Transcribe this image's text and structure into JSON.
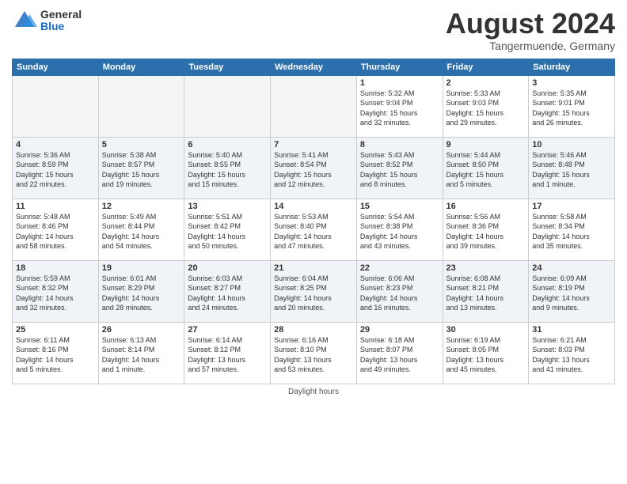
{
  "logo": {
    "general": "General",
    "blue": "Blue"
  },
  "title": "August 2024",
  "location": "Tangermuende, Germany",
  "days_header": [
    "Sunday",
    "Monday",
    "Tuesday",
    "Wednesday",
    "Thursday",
    "Friday",
    "Saturday"
  ],
  "footer": "Daylight hours",
  "weeks": [
    [
      {
        "num": "",
        "info": ""
      },
      {
        "num": "",
        "info": ""
      },
      {
        "num": "",
        "info": ""
      },
      {
        "num": "",
        "info": ""
      },
      {
        "num": "1",
        "info": "Sunrise: 5:32 AM\nSunset: 9:04 PM\nDaylight: 15 hours\nand 32 minutes."
      },
      {
        "num": "2",
        "info": "Sunrise: 5:33 AM\nSunset: 9:03 PM\nDaylight: 15 hours\nand 29 minutes."
      },
      {
        "num": "3",
        "info": "Sunrise: 5:35 AM\nSunset: 9:01 PM\nDaylight: 15 hours\nand 26 minutes."
      }
    ],
    [
      {
        "num": "4",
        "info": "Sunrise: 5:36 AM\nSunset: 8:59 PM\nDaylight: 15 hours\nand 22 minutes."
      },
      {
        "num": "5",
        "info": "Sunrise: 5:38 AM\nSunset: 8:57 PM\nDaylight: 15 hours\nand 19 minutes."
      },
      {
        "num": "6",
        "info": "Sunrise: 5:40 AM\nSunset: 8:55 PM\nDaylight: 15 hours\nand 15 minutes."
      },
      {
        "num": "7",
        "info": "Sunrise: 5:41 AM\nSunset: 8:54 PM\nDaylight: 15 hours\nand 12 minutes."
      },
      {
        "num": "8",
        "info": "Sunrise: 5:43 AM\nSunset: 8:52 PM\nDaylight: 15 hours\nand 8 minutes."
      },
      {
        "num": "9",
        "info": "Sunrise: 5:44 AM\nSunset: 8:50 PM\nDaylight: 15 hours\nand 5 minutes."
      },
      {
        "num": "10",
        "info": "Sunrise: 5:46 AM\nSunset: 8:48 PM\nDaylight: 15 hours\nand 1 minute."
      }
    ],
    [
      {
        "num": "11",
        "info": "Sunrise: 5:48 AM\nSunset: 8:46 PM\nDaylight: 14 hours\nand 58 minutes."
      },
      {
        "num": "12",
        "info": "Sunrise: 5:49 AM\nSunset: 8:44 PM\nDaylight: 14 hours\nand 54 minutes."
      },
      {
        "num": "13",
        "info": "Sunrise: 5:51 AM\nSunset: 8:42 PM\nDaylight: 14 hours\nand 50 minutes."
      },
      {
        "num": "14",
        "info": "Sunrise: 5:53 AM\nSunset: 8:40 PM\nDaylight: 14 hours\nand 47 minutes."
      },
      {
        "num": "15",
        "info": "Sunrise: 5:54 AM\nSunset: 8:38 PM\nDaylight: 14 hours\nand 43 minutes."
      },
      {
        "num": "16",
        "info": "Sunrise: 5:56 AM\nSunset: 8:36 PM\nDaylight: 14 hours\nand 39 minutes."
      },
      {
        "num": "17",
        "info": "Sunrise: 5:58 AM\nSunset: 8:34 PM\nDaylight: 14 hours\nand 35 minutes."
      }
    ],
    [
      {
        "num": "18",
        "info": "Sunrise: 5:59 AM\nSunset: 8:32 PM\nDaylight: 14 hours\nand 32 minutes."
      },
      {
        "num": "19",
        "info": "Sunrise: 6:01 AM\nSunset: 8:29 PM\nDaylight: 14 hours\nand 28 minutes."
      },
      {
        "num": "20",
        "info": "Sunrise: 6:03 AM\nSunset: 8:27 PM\nDaylight: 14 hours\nand 24 minutes."
      },
      {
        "num": "21",
        "info": "Sunrise: 6:04 AM\nSunset: 8:25 PM\nDaylight: 14 hours\nand 20 minutes."
      },
      {
        "num": "22",
        "info": "Sunrise: 6:06 AM\nSunset: 8:23 PM\nDaylight: 14 hours\nand 16 minutes."
      },
      {
        "num": "23",
        "info": "Sunrise: 6:08 AM\nSunset: 8:21 PM\nDaylight: 14 hours\nand 13 minutes."
      },
      {
        "num": "24",
        "info": "Sunrise: 6:09 AM\nSunset: 8:19 PM\nDaylight: 14 hours\nand 9 minutes."
      }
    ],
    [
      {
        "num": "25",
        "info": "Sunrise: 6:11 AM\nSunset: 8:16 PM\nDaylight: 14 hours\nand 5 minutes."
      },
      {
        "num": "26",
        "info": "Sunrise: 6:13 AM\nSunset: 8:14 PM\nDaylight: 14 hours\nand 1 minute."
      },
      {
        "num": "27",
        "info": "Sunrise: 6:14 AM\nSunset: 8:12 PM\nDaylight: 13 hours\nand 57 minutes."
      },
      {
        "num": "28",
        "info": "Sunrise: 6:16 AM\nSunset: 8:10 PM\nDaylight: 13 hours\nand 53 minutes."
      },
      {
        "num": "29",
        "info": "Sunrise: 6:18 AM\nSunset: 8:07 PM\nDaylight: 13 hours\nand 49 minutes."
      },
      {
        "num": "30",
        "info": "Sunrise: 6:19 AM\nSunset: 8:05 PM\nDaylight: 13 hours\nand 45 minutes."
      },
      {
        "num": "31",
        "info": "Sunrise: 6:21 AM\nSunset: 8:03 PM\nDaylight: 13 hours\nand 41 minutes."
      }
    ]
  ]
}
